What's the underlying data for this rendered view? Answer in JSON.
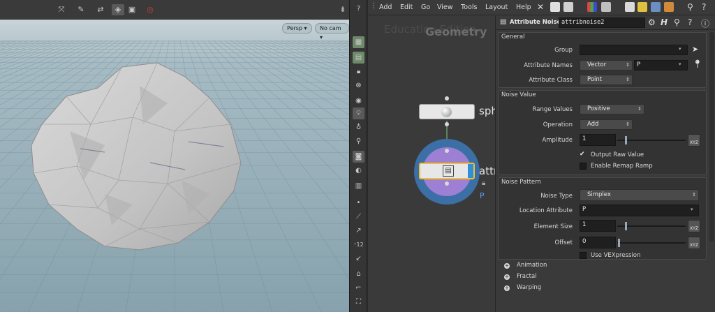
{
  "viewport": {
    "camera_menu": "Persp",
    "cam_menu": "No cam",
    "colors": {
      "toolbar": "#3a3a3a",
      "sky_top": "#cfd8dc",
      "floor": "#8fa6b1"
    }
  },
  "network": {
    "menu": [
      "Add",
      "Edit",
      "Go",
      "View",
      "Tools",
      "Layout",
      "Help"
    ],
    "watermark": "Education Edition",
    "context_label": "Geometry",
    "nodes": [
      {
        "label": "sph",
        "icon": "sphere-icon"
      },
      {
        "label": "attr",
        "icon": "attribnoise-icon",
        "flag": "P"
      }
    ]
  },
  "params": {
    "node_type": "Attribute Noise",
    "node_name": "attribnoise2",
    "general": {
      "title": "General",
      "group_label": "Group",
      "group_value": "",
      "attr_names_label": "Attribute Names",
      "attr_type": "Vector",
      "attr_names_value": "P",
      "attr_class_label": "Attribute Class",
      "attr_class_value": "Point"
    },
    "noise_value": {
      "title": "Noise Value",
      "range_label": "Range Values",
      "range_value": "Positive",
      "operation_label": "Operation",
      "operation_value": "Add",
      "amplitude_label": "Amplitude",
      "amplitude_value": "1",
      "output_raw_label": "Output Raw Value",
      "output_raw_checked": true,
      "remap_label": "Enable Remap Ramp",
      "remap_checked": false,
      "xyz": "XYZ"
    },
    "noise_pattern": {
      "title": "Noise Pattern",
      "type_label": "Noise Type",
      "type_value": "Simplex",
      "location_label": "Location Attribute",
      "location_value": "P",
      "elem_size_label": "Element Size",
      "elem_size_value": "1",
      "offset_label": "Offset",
      "offset_value": "0",
      "vex_label": "Use VEXpression",
      "vex_checked": false
    },
    "folders": [
      "Animation",
      "Fractal",
      "Warping"
    ]
  }
}
